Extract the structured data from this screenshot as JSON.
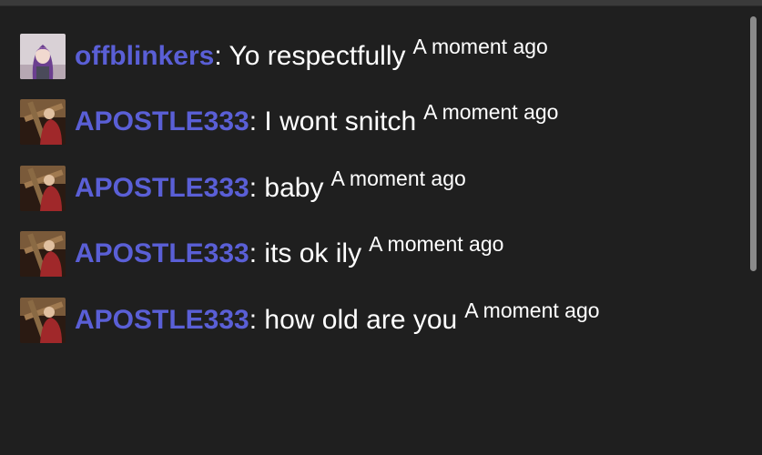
{
  "messages": [
    {
      "user": "offblinkers",
      "text": "Yo respectfully",
      "time": "A moment ago",
      "avatar": "purple-hair-anime-avatar"
    },
    {
      "user": "APOSTLE333",
      "text": "I wont snitch",
      "time": "A moment ago",
      "avatar": "cross-bearer-avatar"
    },
    {
      "user": "APOSTLE333",
      "text": "baby",
      "time": "A moment ago",
      "avatar": "cross-bearer-avatar"
    },
    {
      "user": "APOSTLE333",
      "text": "its ok ily",
      "time": "A moment ago",
      "avatar": "cross-bearer-avatar"
    },
    {
      "user": "APOSTLE333",
      "text": "how old are you",
      "time": "A moment ago",
      "avatar": "cross-bearer-avatar"
    }
  ],
  "colors": {
    "background": "#1f1f1f",
    "username": "#5a5fd6",
    "text": "#ffffff",
    "scrollbar": "#8a8a8a"
  }
}
